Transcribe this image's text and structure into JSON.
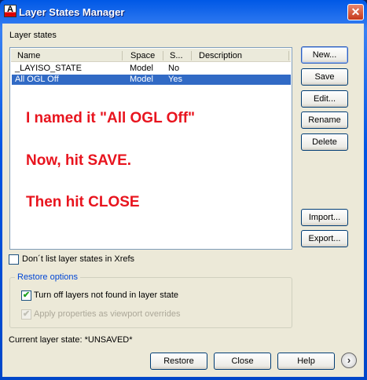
{
  "window": {
    "title": "Layer States Manager",
    "close": "✕",
    "app_icon": "A"
  },
  "layer_states_label": "Layer states",
  "columns": [
    "Name",
    "Space",
    "S...",
    "Description"
  ],
  "rows": [
    {
      "name": "_LAYISO_STATE",
      "space": "Model",
      "saved": "No",
      "description": ""
    },
    {
      "name": "All OGL Off",
      "space": "Model",
      "saved": "Yes",
      "description": ""
    }
  ],
  "annotations": [
    "I named it \"All OGL Off\"",
    "Now, hit SAVE.",
    "Then hit CLOSE"
  ],
  "buttons": {
    "new": "New...",
    "save": "Save",
    "edit": "Edit...",
    "rename": "Rename",
    "delete": "Delete",
    "import": "Import...",
    "export": "Export...",
    "restore": "Restore",
    "close": "Close",
    "help": "Help"
  },
  "dont_list_xrefs": "Don´t list layer states in Xrefs",
  "restore_options": {
    "title": "Restore options",
    "turn_off": "Turn off layers not found in layer state",
    "apply_props": "Apply properties as viewport overrides"
  },
  "current_state": "Current layer state: *UNSAVED*"
}
